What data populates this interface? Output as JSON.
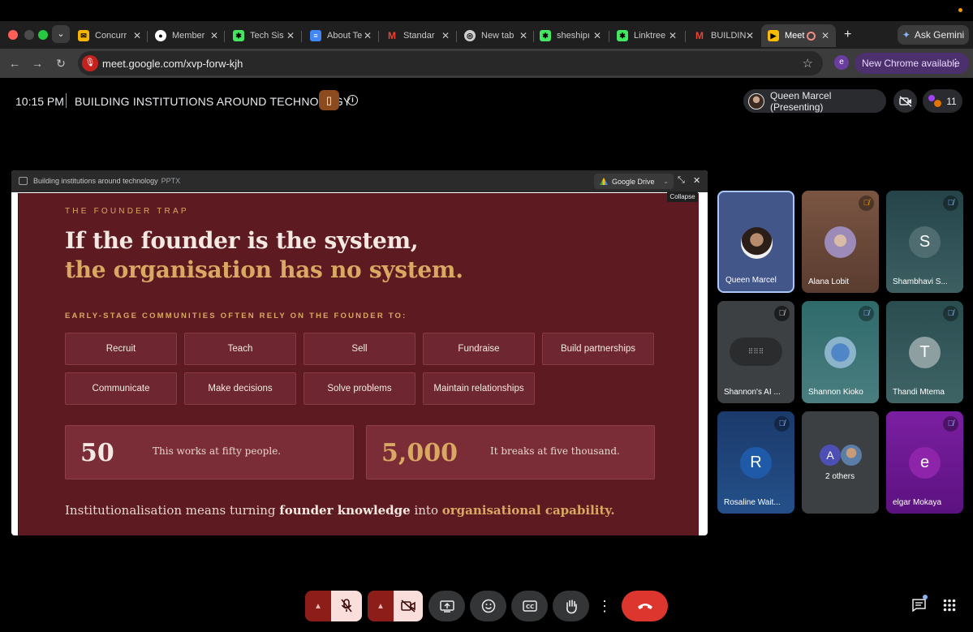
{
  "browser": {
    "tabs": [
      {
        "label": "Concurr",
        "icon": "mail-icon",
        "color": "#f4b400"
      },
      {
        "label": "Member",
        "icon": "github-icon",
        "color": "#ffffff"
      },
      {
        "label": "Tech Sis",
        "icon": "linktree-icon",
        "color": "#43e660"
      },
      {
        "label": "About Te",
        "icon": "docs-icon",
        "color": "#4285f4"
      },
      {
        "label": "Standar",
        "icon": "gmail-icon",
        "color": "#ea4335"
      },
      {
        "label": "New tab",
        "icon": "chrome-icon",
        "color": "#cfcfcf"
      },
      {
        "label": "sheshipı",
        "icon": "linktree-icon",
        "color": "#43e660"
      },
      {
        "label": "Linktree",
        "icon": "linktree-icon",
        "color": "#43e660"
      },
      {
        "label": "BUILDIN",
        "icon": "gmail-icon",
        "color": "#ea4335"
      },
      {
        "label": "Meet",
        "icon": "meet-icon",
        "color": "#fbbc04"
      }
    ],
    "new_tab": "+",
    "ask_gemini": "Ask Gemini",
    "url": "meet.google.com/xvp-forw-kjh",
    "profile_initial": "e",
    "new_chrome": "New Chrome available"
  },
  "meeting": {
    "time": "10:15 PM",
    "title": "BUILDING INSTITUTIONS AROUND TECHNOLOGY",
    "presenter_label": "Queen Marcel (Presenting)",
    "participant_count": "11"
  },
  "presentation": {
    "file_name": "Building institutions around technology",
    "file_type": "PPTX",
    "drive_label": "Google Drive",
    "tooltip": "Collapse",
    "slide": {
      "eyebrow": "THE FOUNDER TRAP",
      "headline_1": "If the founder is the system,",
      "headline_2": "the organisation has no system.",
      "rely_label": "EARLY-STAGE COMMUNITIES OFTEN RELY ON THE FOUNDER TO:",
      "chips_row1": [
        "Recruit",
        "Teach",
        "Sell",
        "Fundraise",
        "Build partnerships"
      ],
      "chips_row2": [
        "Communicate",
        "Make decisions",
        "Solve problems",
        "Maintain relationships"
      ],
      "stat1_num": "50",
      "stat1_text": "This works at fifty people.",
      "stat2_num": "5,000",
      "stat2_text": "It breaks at five thousand.",
      "closing_pre": "Institutionalisation means turning ",
      "closing_b1": "founder knowledge",
      "closing_mid": " into ",
      "closing_b2": "organisational capability."
    }
  },
  "participants": [
    {
      "name": "Queen Marcel"
    },
    {
      "name": "Alana Lobit"
    },
    {
      "name": "Shambhavi S...",
      "initial": "S"
    },
    {
      "name": "Shannon's AI ..."
    },
    {
      "name": "Shannon Kioko"
    },
    {
      "name": "Thandi Mtema",
      "initial": "T"
    },
    {
      "name": "Rosaline Wait...",
      "initial": "R"
    },
    {
      "name": "2 others",
      "initial": "A"
    },
    {
      "name": "elgar Mokaya",
      "initial": "e"
    }
  ]
}
